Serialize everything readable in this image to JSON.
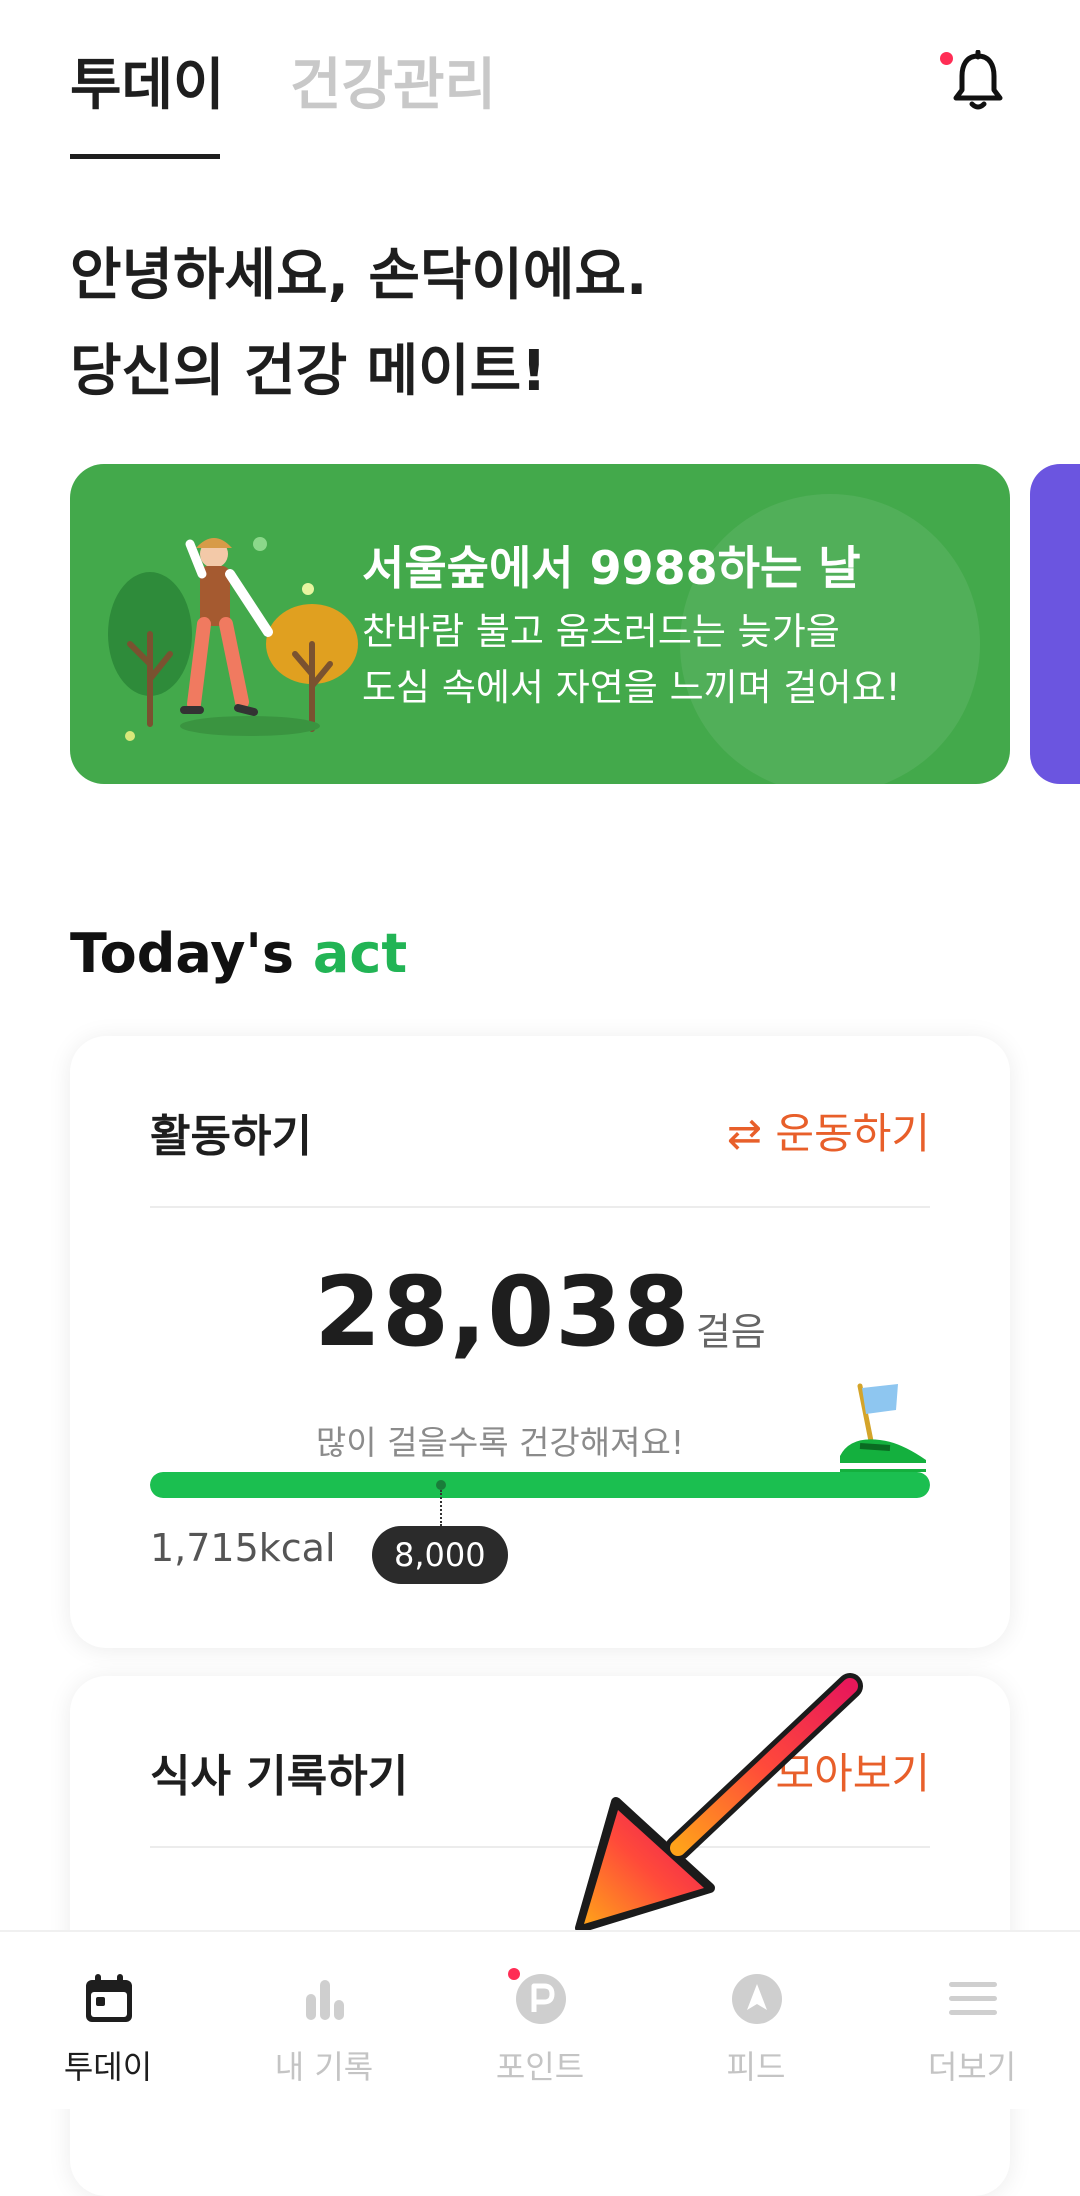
{
  "tabs": {
    "today": "투데이",
    "health": "건강관리"
  },
  "greeting": {
    "line1": "안녕하세요, 손닥이에요.",
    "line2": "당신의 건강 메이트!"
  },
  "banner": {
    "title": "서울숲에서 9988하는 날",
    "body_line1": "찬바람 불고 움츠러드는 늦가을",
    "body_line2": "도심 속에서 자연을 느끼며 걸어요!"
  },
  "section": {
    "title_prefix": "Today's ",
    "title_accent": "act"
  },
  "activity": {
    "title": "활동하기",
    "link": "⇄ 운동하기",
    "steps": "28,038",
    "steps_unit": "걸음",
    "hint": "많이 걸을수록 건강해져요!",
    "progress_fraction": 1.0,
    "kcal": "1,715kcal",
    "goal": "8,000"
  },
  "meal": {
    "title": "식사 기록하기",
    "link": "모아보기"
  },
  "bottom_nav": [
    {
      "label": "투데이",
      "icon": "calendar-icon"
    },
    {
      "label": "내 기록",
      "icon": "bar-chart-icon"
    },
    {
      "label": "포인트",
      "icon": "point-icon"
    },
    {
      "label": "피드",
      "icon": "compass-icon"
    },
    {
      "label": "더보기",
      "icon": "menu-icon"
    }
  ],
  "colors": {
    "accent_green": "#22b455",
    "banner_green": "#43a94b",
    "link_orange": "#e85f2a",
    "notification_red": "#ff2d55"
  }
}
